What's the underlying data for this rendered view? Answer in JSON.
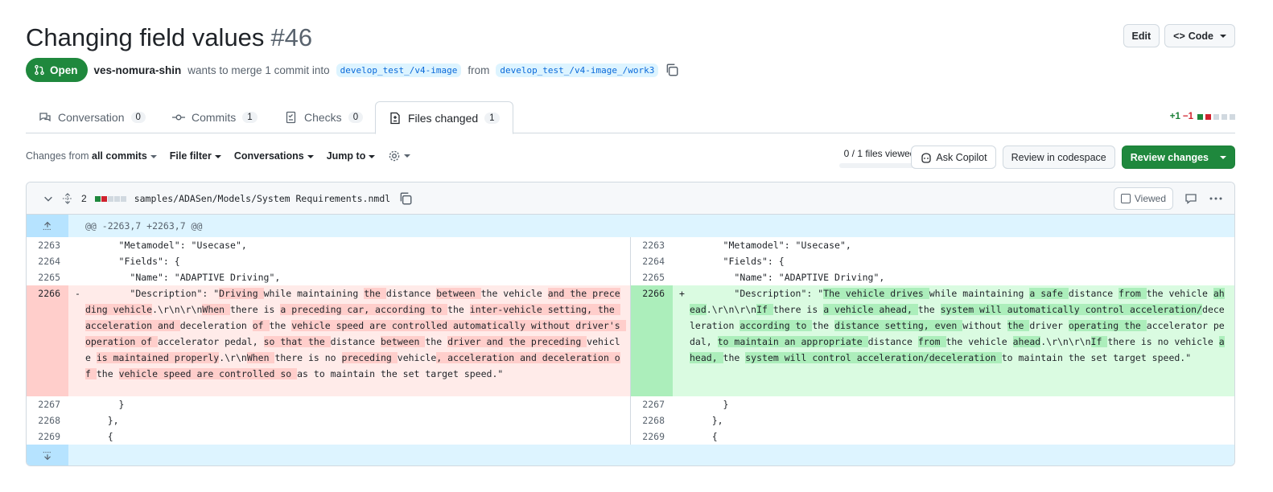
{
  "pr": {
    "title": "Changing field values",
    "number": "#46",
    "state": "Open",
    "author": "ves-nomura-shin",
    "merge_text": "wants to merge 1 commit into",
    "base_branch": "develop_test_/v4-image",
    "from_text": "from",
    "head_branch": "develop_test_/v4-image_/work3"
  },
  "header_actions": {
    "edit": "Edit",
    "code": "Code"
  },
  "tabs": [
    {
      "label": "Conversation",
      "count": "0",
      "icon": "comment-discussion-icon"
    },
    {
      "label": "Commits",
      "count": "1",
      "icon": "git-commit-icon"
    },
    {
      "label": "Checks",
      "count": "0",
      "icon": "checklist-icon"
    },
    {
      "label": "Files changed",
      "count": "1",
      "icon": "file-diff-icon",
      "active": true
    }
  ],
  "diffstat": {
    "additions": "+1",
    "deletions": "−1"
  },
  "toolbar": {
    "changes_from_prefix": "Changes from",
    "changes_from_value": "all commits",
    "file_filter": "File filter",
    "conversations": "Conversations",
    "jump_to": "Jump to",
    "files_viewed": "0 / 1 files viewed",
    "ask_copilot": "Ask Copilot",
    "review_codespace": "Review in codespace",
    "review_changes": "Review changes"
  },
  "file": {
    "changes": "2",
    "path": "samples/ADASen/Models/System Requirements.nmdl",
    "viewed_label": "Viewed",
    "hunk_header": "@@ -2263,7 +2263,7 @@"
  },
  "diff": {
    "left": [
      {
        "num": "2263",
        "text": "      \"Metamodel\": \"Usecase\","
      },
      {
        "num": "2264",
        "text": "      \"Fields\": {"
      },
      {
        "num": "2265",
        "text": "        \"Name\": \"ADAPTIVE Driving\","
      },
      {
        "num": "2267",
        "text": "      }"
      },
      {
        "num": "2268",
        "text": "    },"
      },
      {
        "num": "2269",
        "text": "    {"
      }
    ],
    "right": [
      {
        "num": "2263",
        "text": "      \"Metamodel\": \"Usecase\","
      },
      {
        "num": "2264",
        "text": "      \"Fields\": {"
      },
      {
        "num": "2265",
        "text": "        \"Name\": \"ADAPTIVE Driving\","
      },
      {
        "num": "2267",
        "text": "      }"
      },
      {
        "num": "2268",
        "text": "    },"
      },
      {
        "num": "2269",
        "text": "    {"
      }
    ],
    "deleted": {
      "num": "2266",
      "marker": "-",
      "segments": [
        {
          "t": "        \"Description\": \"",
          "h": false
        },
        {
          "t": "Driving ",
          "h": true
        },
        {
          "t": "while maintaining ",
          "h": false
        },
        {
          "t": "the ",
          "h": true
        },
        {
          "t": "distance ",
          "h": false
        },
        {
          "t": "between ",
          "h": true
        },
        {
          "t": "the vehicle ",
          "h": false
        },
        {
          "t": "and the preceding vehicle",
          "h": true
        },
        {
          "t": ".\\r\\n\\r\\n",
          "h": false
        },
        {
          "t": "When ",
          "h": true
        },
        {
          "t": "there is ",
          "h": false
        },
        {
          "t": "a preceding car, according to ",
          "h": true
        },
        {
          "t": "the ",
          "h": false
        },
        {
          "t": "inter-vehicle setting, the acceleration and ",
          "h": true
        },
        {
          "t": "deceleration ",
          "h": false
        },
        {
          "t": "of ",
          "h": true
        },
        {
          "t": "the ",
          "h": false
        },
        {
          "t": "vehicle speed are controlled automatically without driver's operation of ",
          "h": true
        },
        {
          "t": "accelerator pedal, ",
          "h": false
        },
        {
          "t": "so that the ",
          "h": true
        },
        {
          "t": "distance ",
          "h": false
        },
        {
          "t": "between ",
          "h": true
        },
        {
          "t": "the ",
          "h": false
        },
        {
          "t": "driver and the preceding ",
          "h": true
        },
        {
          "t": "vehicle ",
          "h": false
        },
        {
          "t": "is maintained properly",
          "h": true
        },
        {
          "t": ".\\r\\n",
          "h": false
        },
        {
          "t": "When ",
          "h": true
        },
        {
          "t": "there is no ",
          "h": false
        },
        {
          "t": "preceding ",
          "h": true
        },
        {
          "t": "vehicle",
          "h": false
        },
        {
          "t": ", acceleration and deceleration of ",
          "h": true
        },
        {
          "t": "the ",
          "h": false
        },
        {
          "t": "vehicle speed are controlled so ",
          "h": true
        },
        {
          "t": "as to maintain the set target speed.\"",
          "h": false
        }
      ]
    },
    "added": {
      "num": "2266",
      "marker": "+",
      "segments": [
        {
          "t": "        \"Description\": \"",
          "h": false
        },
        {
          "t": "The vehicle drives ",
          "h": true
        },
        {
          "t": "while maintaining ",
          "h": false
        },
        {
          "t": "a safe ",
          "h": true
        },
        {
          "t": "distance ",
          "h": false
        },
        {
          "t": "from ",
          "h": true
        },
        {
          "t": "the vehicle ",
          "h": false
        },
        {
          "t": "ahead",
          "h": true
        },
        {
          "t": ".\\r\\n\\r\\n",
          "h": false
        },
        {
          "t": "If ",
          "h": true
        },
        {
          "t": "there is ",
          "h": false
        },
        {
          "t": "a vehicle ahead, ",
          "h": true
        },
        {
          "t": "the ",
          "h": false
        },
        {
          "t": "system will automatically control acceleration/",
          "h": true
        },
        {
          "t": "deceleration ",
          "h": false
        },
        {
          "t": "according to ",
          "h": true
        },
        {
          "t": "the ",
          "h": false
        },
        {
          "t": "distance setting, even ",
          "h": true
        },
        {
          "t": "without ",
          "h": false
        },
        {
          "t": "the ",
          "h": true
        },
        {
          "t": "driver ",
          "h": false
        },
        {
          "t": "operating the ",
          "h": true
        },
        {
          "t": "accelerator pedal, ",
          "h": false
        },
        {
          "t": "to maintain an appropriate ",
          "h": true
        },
        {
          "t": "distance ",
          "h": false
        },
        {
          "t": "from ",
          "h": true
        },
        {
          "t": "the vehicle ",
          "h": false
        },
        {
          "t": "ahead",
          "h": true
        },
        {
          "t": ".\\r\\n\\r\\n",
          "h": false
        },
        {
          "t": "If ",
          "h": true
        },
        {
          "t": "there is no vehicle ",
          "h": false
        },
        {
          "t": "ahead, ",
          "h": true
        },
        {
          "t": "the ",
          "h": false
        },
        {
          "t": "system will control acceleration/deceleration ",
          "h": true
        },
        {
          "t": "to maintain the set target speed.\"",
          "h": false
        }
      ]
    }
  }
}
